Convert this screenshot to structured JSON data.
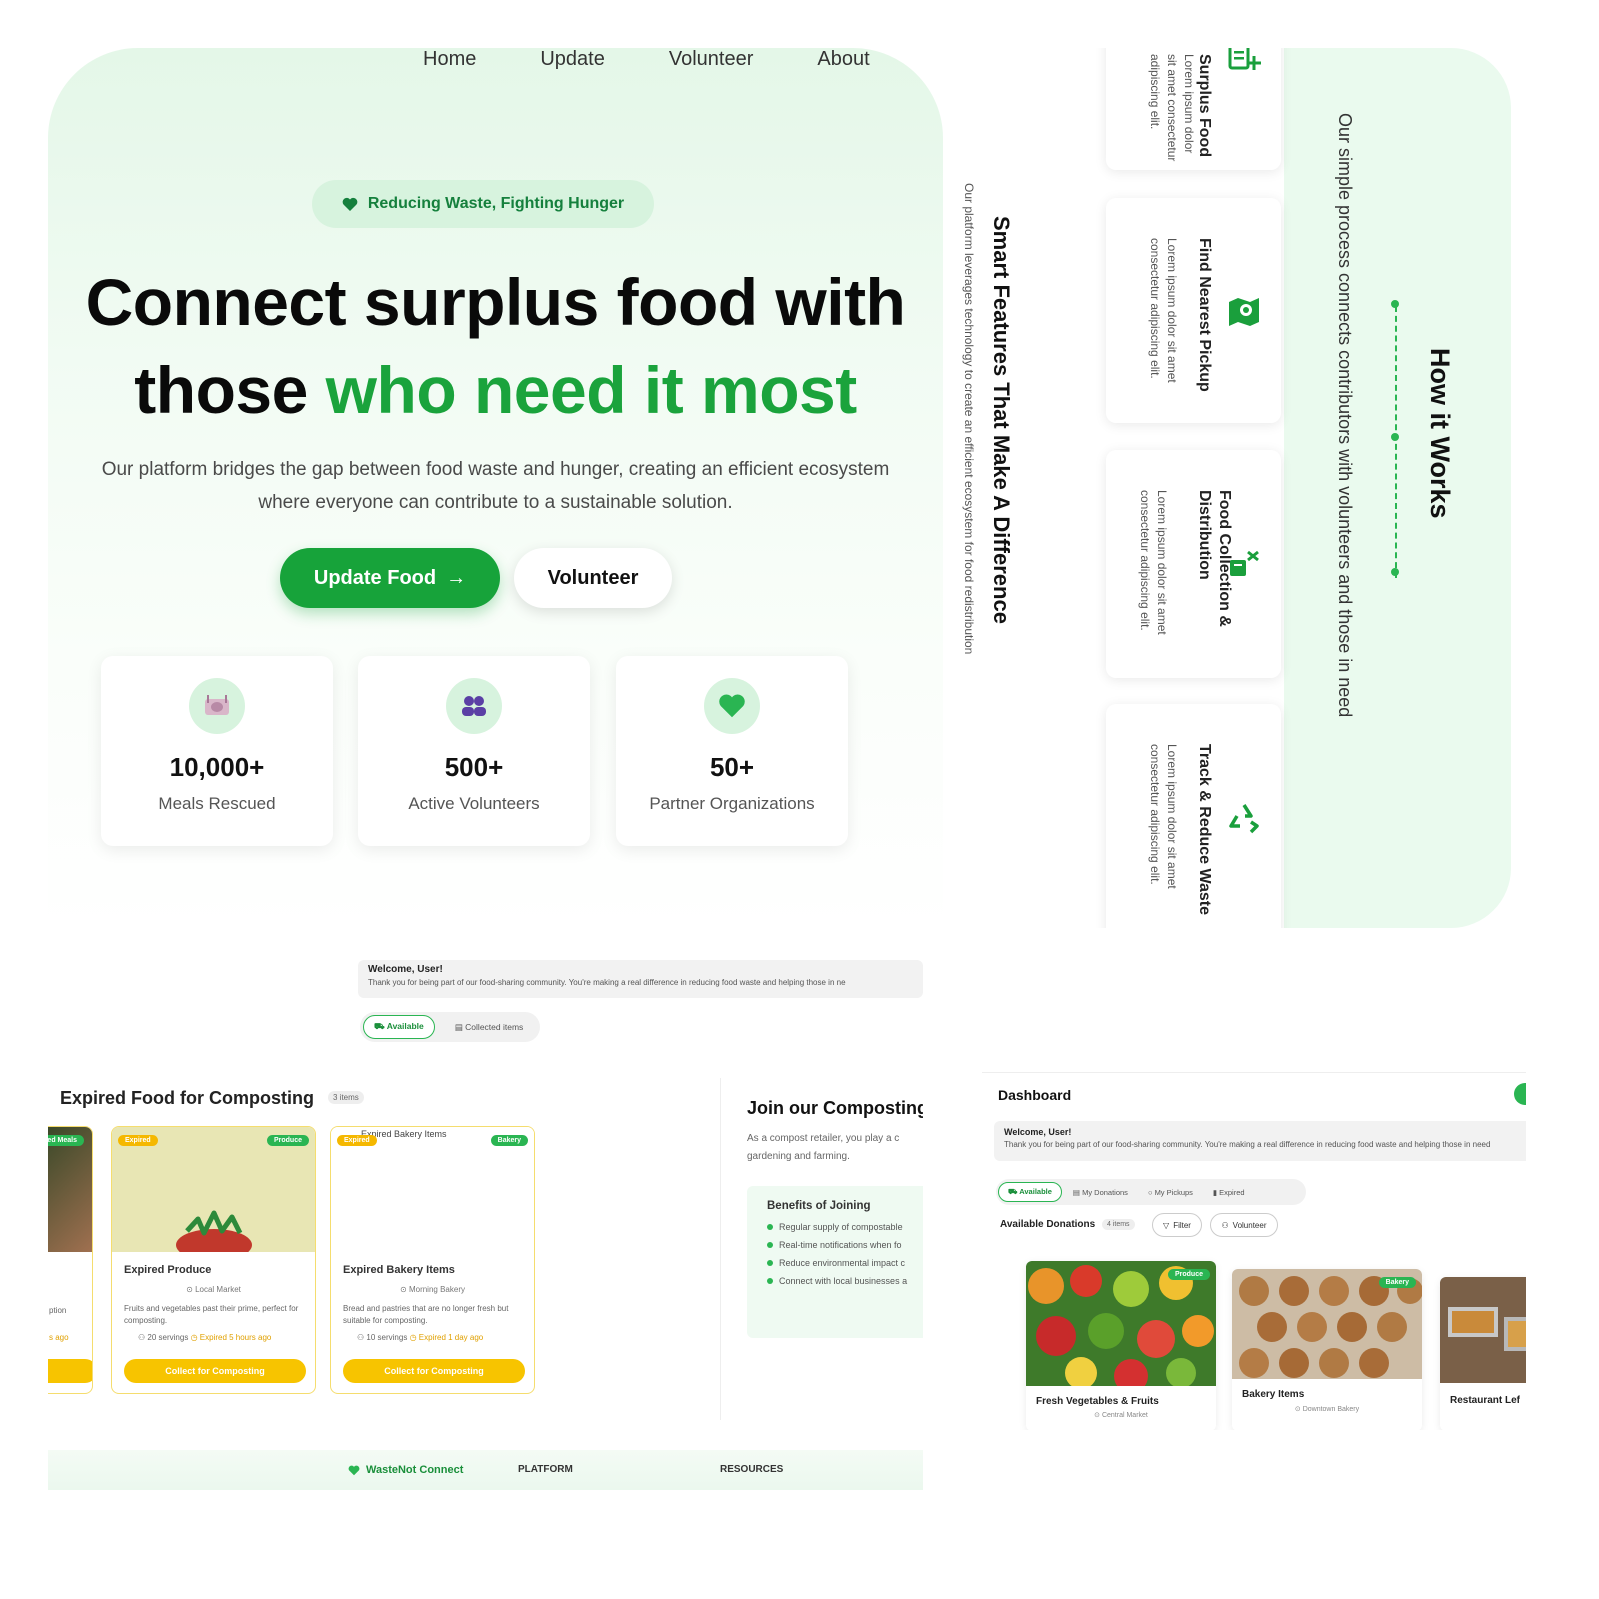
{
  "hero": {
    "nav": [
      "Home",
      "Update",
      "Volunteer",
      "About"
    ],
    "pill": "Reducing Waste, Fighting Hunger",
    "headline_line1": "Connect surplus food with",
    "headline_line2_plain": "those",
    "headline_line2_green": "who need it most",
    "subtitle": "Our platform bridges the gap between food waste and hunger, creating an efficient ecosystem where everyone can contribute to a sustainable solution.",
    "primary_button": "Update Food",
    "secondary_button": "Volunteer",
    "stats": [
      {
        "value": "10,000+",
        "label": "Meals Rescued",
        "icon": "plate-icon"
      },
      {
        "value": "500+",
        "label": "Active Volunteers",
        "icon": "users-icon"
      },
      {
        "value": "50+",
        "label": "Partner Organizations",
        "icon": "heart-icon"
      }
    ],
    "accent_color": "#17a33a"
  },
  "how_it_works": {
    "title": "How it Works",
    "subtitle": "Our simple process connects contributors with volunteers and those in need",
    "features_title": "Smart Features That Make A Difference",
    "features_subtitle": "Our platform leverages technology to create an efficient ecosystem for food redistribution",
    "cards": [
      {
        "title": "Surplus Food",
        "desc": "Lorem ipsum dolor sit amet consectetur adipiscing elit.",
        "icon": "list-add-icon"
      },
      {
        "title": "Find Nearest Pickup",
        "desc": "Lorem ipsum dolor sit amet consectetur adipiscing elit.",
        "icon": "map-pin-icon"
      },
      {
        "title": "Food Collection & Distribution",
        "desc": "Lorem ipsum dolor sit amet consectetur adipiscing elit.",
        "icon": "food-collection-icon"
      },
      {
        "title": "Track & Reduce Waste",
        "desc": "Lorem ipsum dolor sit amet consectetur adipiscing elit.",
        "icon": "recycle-icon"
      }
    ]
  },
  "compost_dashboard": {
    "welcome_title": "Welcome, User!",
    "welcome_text": "Thank you for being part of our food-sharing community. You're making a real difference in reducing food waste and helping those in ne",
    "tabs": [
      "Available",
      "Collected items"
    ],
    "section_title": "Expired Food for Composting",
    "section_count": "3 items",
    "cards": [
      {
        "badge": "Expired",
        "category": "Produce",
        "title": "Expired Produce",
        "location": "Local Market",
        "desc": "Fruits and vegetables past their prime, perfect for composting.",
        "servings": "20 servings",
        "expired": "Expired 5 hours ago",
        "button": "Collect for Composting"
      },
      {
        "badge": "Expired",
        "category": "Bakery",
        "image_alt": "Expired Bakery Items",
        "title": "Expired Bakery Items",
        "location": "Morning Bakery",
        "desc": "Bread and pastries that are no longer fresh but suitable for composting.",
        "servings": "10 servings",
        "expired": "Expired 1 day ago",
        "button": "Collect for Composting"
      }
    ],
    "partial_card": {
      "badge": "Prepared Meals",
      "desc_tail": "ption",
      "time_tail": "s ago"
    },
    "join_title": "Join our Composting",
    "join_desc_line1": "As a compost retailer, you play a c",
    "join_desc_line2": "gardening and farming.",
    "benefits_title": "Benefits of Joining",
    "benefits": [
      "Regular supply of compostable",
      "Real-time notifications when fo",
      "Reduce environmental impact c",
      "Connect with local businesses a"
    ],
    "footer_brand": "WasteNot Connect",
    "footer_platform": "PLATFORM",
    "footer_resources": "RESOURCES"
  },
  "donations_dashboard": {
    "title": "Dashboard",
    "welcome_title": "Welcome, User!",
    "welcome_text": "Thank you for being part of our food-sharing community. You're making a real difference in reducing food waste and helping those in need",
    "tabs": [
      "Available",
      "My Donations",
      "My Pickups",
      "Expired"
    ],
    "section_title": "Available Donations",
    "section_count": "4 items",
    "filter_label": "Filter",
    "volunteer_label": "Volunteer",
    "cards": [
      {
        "category": "Produce",
        "title": "Fresh Vegetables & Fruits",
        "location": "Central Market"
      },
      {
        "category": "Bakery",
        "title": "Bakery Items",
        "location": "Downtown Bakery"
      },
      {
        "category": "",
        "title": "Restaurant Lef",
        "location": ""
      }
    ]
  }
}
